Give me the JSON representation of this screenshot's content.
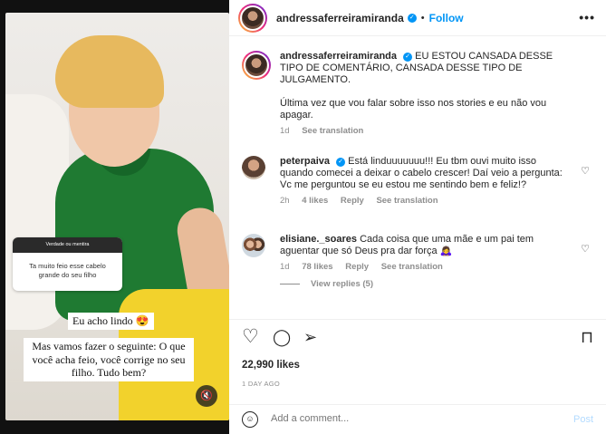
{
  "story": {
    "question_header": "Verdade ou mentira",
    "question_text": "Ta muito feio esse cabelo grande do seu filho",
    "caption_1": "Eu acho lindo 😍",
    "caption_2": "Mas vamos fazer o seguinte: O que você acha feio, você corrige no seu filho. Tudo bem?",
    "mute_icon": "🔇"
  },
  "header": {
    "username": "andressaferreiramiranda",
    "verified_mark": "✓",
    "separator": "•",
    "follow_label": "Follow",
    "more_label": "•••"
  },
  "caption": {
    "username": "andressaferreiramiranda",
    "text": "EU ESTOU CANSADA DESSE TIPO DE COMENTÁRIO, CANSADA DESSE TIPO DE JULGAMENTO.",
    "text2": "Última vez que vou falar sobre isso nos stories e eu não vou apagar.",
    "time": "1d",
    "see_translation": "See translation"
  },
  "comments": [
    {
      "username": "peterpaiva",
      "verified": true,
      "text": "Está linduuuuuuu!!! Eu tbm ouvi muito isso quando comecei a deixar o cabelo crescer! Daí veio a pergunta: Vc me perguntou se eu estou me sentindo bem e feliz!?",
      "time": "2h",
      "likes": "4 likes",
      "reply": "Reply",
      "see_translation": "See translation"
    },
    {
      "username": "elisiane._soares",
      "verified": false,
      "text": "Cada coisa que uma mãe e um pai tem aguentar que só Deus pra dar força 🙇‍♀️",
      "time": "1d",
      "likes": "78 likes",
      "reply": "Reply",
      "see_translation": "See translation",
      "view_replies": "View replies (5)"
    }
  ],
  "actions": {
    "like_icon": "♡",
    "comment_icon": "◯",
    "share_icon": "➢",
    "save_icon": "⊓"
  },
  "likes": "22,990 likes",
  "posted_ago": "1 DAY AGO",
  "add_comment": {
    "placeholder": "Add a comment...",
    "emoji_icon": "☺",
    "post_label": "Post"
  }
}
